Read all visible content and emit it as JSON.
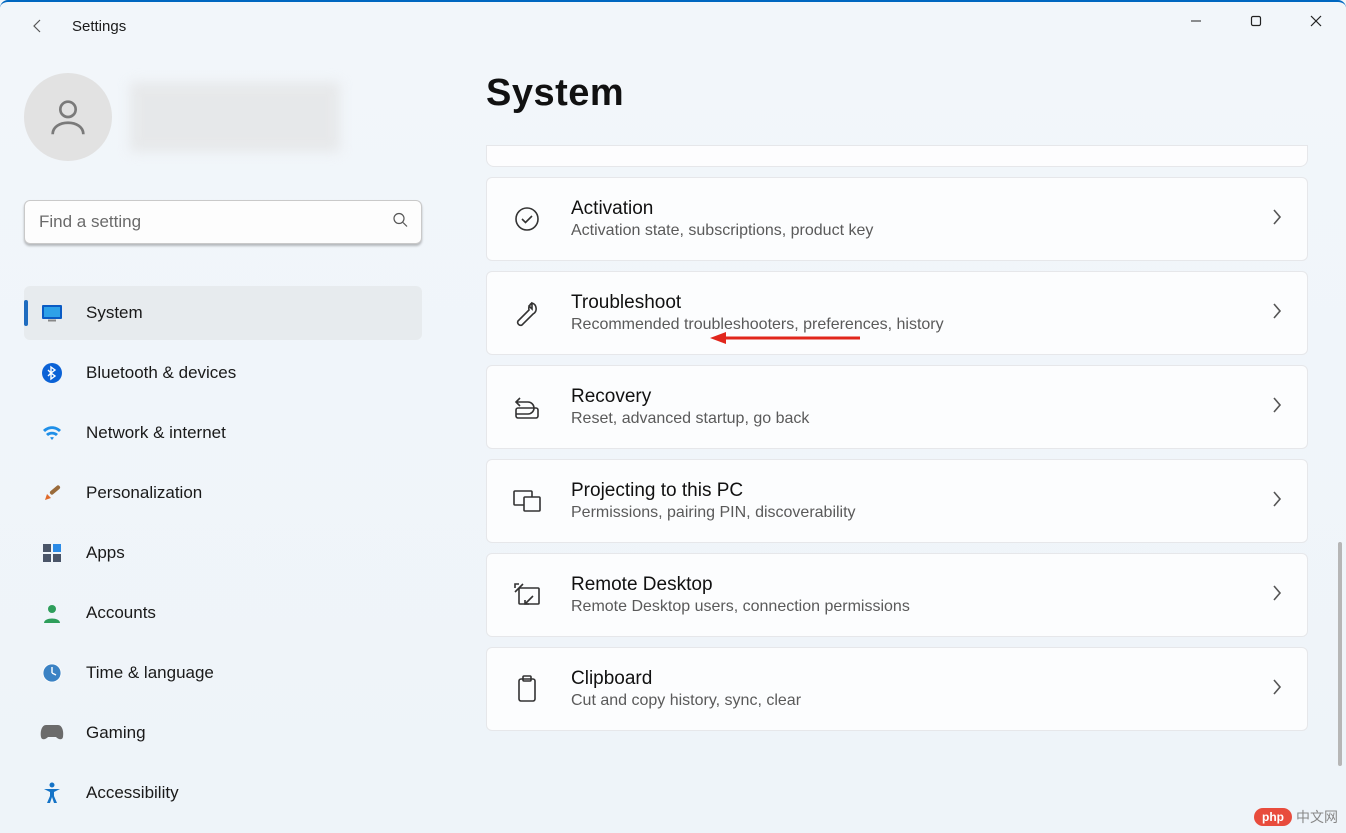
{
  "titlebar": {
    "app_title": "Settings"
  },
  "search": {
    "placeholder": "Find a setting"
  },
  "sidebar": {
    "items": [
      {
        "label": "System",
        "icon": "display-icon",
        "active": true
      },
      {
        "label": "Bluetooth & devices",
        "icon": "bluetooth-icon",
        "active": false
      },
      {
        "label": "Network & internet",
        "icon": "wifi-icon",
        "active": false
      },
      {
        "label": "Personalization",
        "icon": "paintbrush-icon",
        "active": false
      },
      {
        "label": "Apps",
        "icon": "apps-icon",
        "active": false
      },
      {
        "label": "Accounts",
        "icon": "person-icon",
        "active": false
      },
      {
        "label": "Time & language",
        "icon": "clock-globe-icon",
        "active": false
      },
      {
        "label": "Gaming",
        "icon": "gamepad-icon",
        "active": false
      },
      {
        "label": "Accessibility",
        "icon": "accessibility-icon",
        "active": false
      }
    ]
  },
  "page": {
    "title": "System"
  },
  "cards": [
    {
      "title": "Activation",
      "desc": "Activation state, subscriptions, product key",
      "icon": "check-circle-icon"
    },
    {
      "title": "Troubleshoot",
      "desc": "Recommended troubleshooters, preferences, history",
      "icon": "wrench-icon"
    },
    {
      "title": "Recovery",
      "desc": "Reset, advanced startup, go back",
      "icon": "recovery-icon"
    },
    {
      "title": "Projecting to this PC",
      "desc": "Permissions, pairing PIN, discoverability",
      "icon": "project-icon"
    },
    {
      "title": "Remote Desktop",
      "desc": "Remote Desktop users, connection permissions",
      "icon": "remote-desktop-icon"
    },
    {
      "title": "Clipboard",
      "desc": "Cut and copy history, sync, clear",
      "icon": "clipboard-icon"
    }
  ],
  "watermark": {
    "badge": "php",
    "text": "中文网"
  },
  "colors": {
    "accent": "#1f6cbf",
    "danger": "#e84c3d"
  }
}
